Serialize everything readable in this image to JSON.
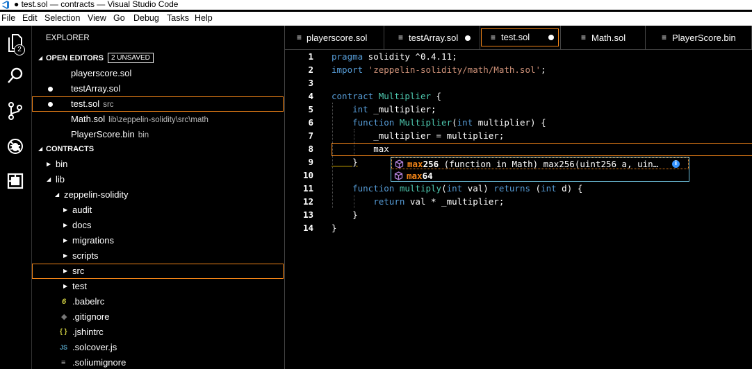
{
  "titlebar": {
    "title": "● test.sol — contracts — Visual Studio Code"
  },
  "menu": [
    "File",
    "Edit",
    "Selection",
    "View",
    "Go",
    "Debug",
    "Tasks",
    "Help"
  ],
  "activity": {
    "explorer_badge": "2"
  },
  "sidebar": {
    "header": "EXPLORER",
    "open_editors": {
      "label": "OPEN EDITORS",
      "unsaved": "2 UNSAVED",
      "items": [
        {
          "name": "playerscore.sol",
          "desc": "",
          "dirty": false
        },
        {
          "name": "testArray.sol",
          "desc": "",
          "dirty": true
        },
        {
          "name": "test.sol",
          "desc": "src",
          "dirty": true
        },
        {
          "name": "Math.sol",
          "desc": "lib\\zeppelin-solidity\\src\\math",
          "dirty": false
        },
        {
          "name": "PlayerScore.bin",
          "desc": "bin",
          "dirty": false
        }
      ]
    },
    "contracts": {
      "label": "CONTRACTS",
      "items": [
        {
          "name": "bin"
        },
        {
          "name": "lib"
        },
        {
          "name": "zeppelin-solidity"
        },
        {
          "name": "audit"
        },
        {
          "name": "docs"
        },
        {
          "name": "migrations"
        },
        {
          "name": "scripts"
        },
        {
          "name": "src"
        },
        {
          "name": "test"
        },
        {
          "name": ".babelrc",
          "icon": "6"
        },
        {
          "name": ".gitignore",
          "icon": "◆"
        },
        {
          "name": ".jshintrc",
          "icon": "{ }"
        },
        {
          "name": ".solcover.js",
          "icon": "JS"
        },
        {
          "name": ".soliumignore",
          "icon": "≡"
        }
      ]
    }
  },
  "tabs": [
    {
      "label": "playerscore.sol"
    },
    {
      "label": "testArray.sol"
    },
    {
      "label": "test.sol"
    },
    {
      "label": "Math.sol"
    },
    {
      "label": "PlayerScore.bin"
    }
  ],
  "editor": {
    "line_numbers": [
      "1",
      "2",
      "3",
      "4",
      "5",
      "6",
      "7",
      "8",
      "9",
      "10",
      "11",
      "12",
      "13",
      "14"
    ],
    "lines": [
      {
        "kw": "pragma",
        "rest": " solidity ^0.4.11;"
      },
      {
        "kw": "import",
        "str": " 'zeppelin-solidity/math/Math.sol'",
        "rest": ";"
      },
      {
        "rest": ""
      },
      {
        "kw": "contract",
        "ty": " Multiplier",
        "rest": " {"
      },
      {
        "pre": "    ",
        "kw": "int",
        "rest": " _multiplier;"
      },
      {
        "pre": "    ",
        "kw": "function",
        "ty": " Multiplier",
        "rest": "(",
        "kw2": "int",
        "rest2": " multiplier) {"
      },
      {
        "pre": "        ",
        "rest": "_multiplier = multiplier;"
      },
      {
        "pre": "        ",
        "rest": "max"
      },
      {
        "pre": "    ",
        "rest": "}"
      },
      {
        "rest": ""
      },
      {
        "pre": "    ",
        "kw": "function",
        "ty": " multiply",
        "rest": "(",
        "kw2": "int",
        "rest2": " val) ",
        "kw3": "returns",
        "rest3": " (",
        "kw4": "int",
        "rest4": " d) {"
      },
      {
        "pre": "        ",
        "kw": "return",
        "rest": " val * _multiplier;"
      },
      {
        "pre": "    ",
        "rest": "}"
      },
      {
        "rest": "}"
      }
    ]
  },
  "suggest": [
    {
      "match": "max",
      "rest": "256",
      "detail": "  (function in Math) max256(uint256 a, uin…"
    },
    {
      "match": "max",
      "rest": "64",
      "detail": ""
    }
  ]
}
